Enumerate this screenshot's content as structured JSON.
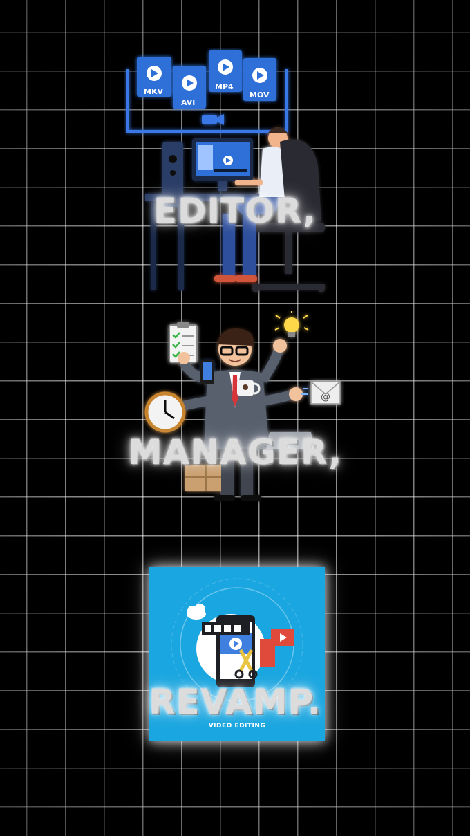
{
  "formats": [
    "MKV",
    "AVI",
    "MP4",
    "MOV"
  ],
  "words": {
    "editor": "EDITOR,",
    "manager": "MANAGER,",
    "revamp": "REVAMP."
  },
  "revamp_card": {
    "caption": "VIDEO EDITING",
    "background": "#1aa6e0"
  },
  "email_symbol": "@",
  "colors": {
    "background": "#000000",
    "grid": "#ffffff",
    "icon_blue": "#2f6fd8"
  }
}
